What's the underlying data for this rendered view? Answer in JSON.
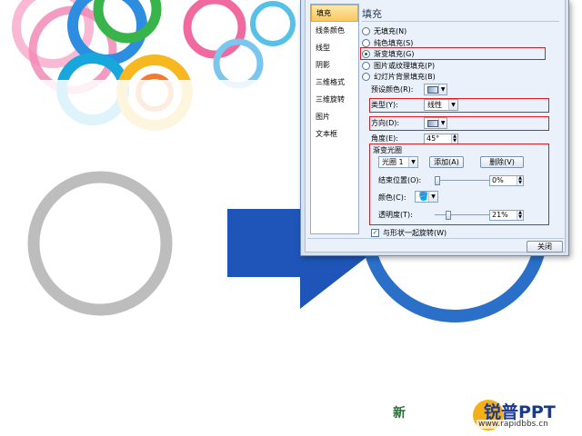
{
  "slide": {
    "brand_left": "新",
    "brand_title": "锐普PPT",
    "brand_url": "www.rapidbbs.cn",
    "colors": {
      "arrow": "#1f55b8",
      "ring_left": "#bdbdbd",
      "ring_right": "#2a6fc8"
    }
  },
  "nav": {
    "items": [
      {
        "label": "填充"
      },
      {
        "label": "线条颜色"
      },
      {
        "label": "线型"
      },
      {
        "label": "阴影"
      },
      {
        "label": "三维格式"
      },
      {
        "label": "三维旋转"
      },
      {
        "label": "图片"
      },
      {
        "label": "文本框"
      }
    ],
    "active_index": 0
  },
  "fill": {
    "title": "填充",
    "options": [
      {
        "label": "无填充(N)",
        "checked": false
      },
      {
        "label": "纯色填充(S)",
        "checked": false
      },
      {
        "label": "渐变填充(G)",
        "checked": true
      },
      {
        "label": "图片或纹理填充(P)",
        "checked": false
      },
      {
        "label": "幻灯片背景填充(B)",
        "checked": false
      }
    ],
    "preset_label": "预设颜色(R):",
    "type_label": "类型(Y):",
    "type_value": "线性",
    "direction_label": "方向(D):",
    "angle_label": "角度(E):",
    "angle_value": "45°",
    "stops": {
      "section_label": "渐变光圈",
      "stop_value": "光圈 1",
      "add_label": "添加(A)",
      "delete_label": "删除(V)",
      "end_position_label": "结束位置(O):",
      "end_position_value": "0%",
      "color_label": "颜色(C):",
      "transparency_label": "透明度(T):",
      "transparency_value": "21%"
    },
    "rotate_with_shape_label": "与形状一起旋转(W)",
    "rotate_with_shape_checked": true
  },
  "footer": {
    "close_label": "关闭"
  }
}
